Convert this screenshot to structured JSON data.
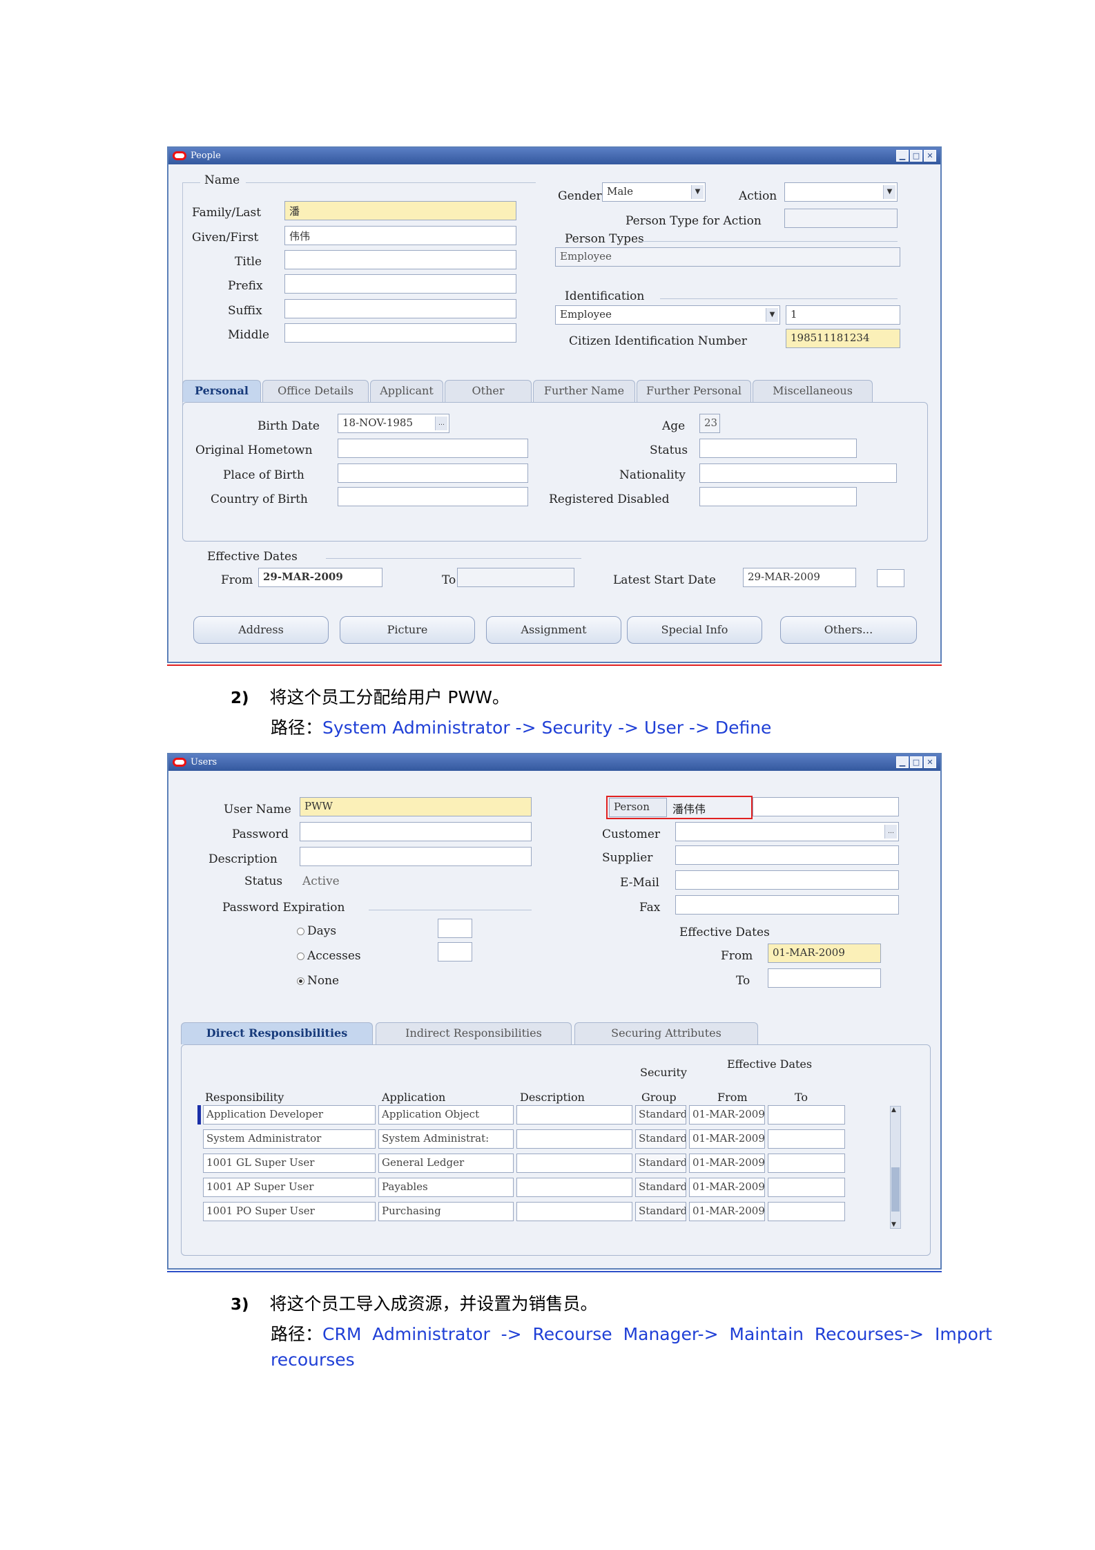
{
  "people_window": {
    "title": "People",
    "name_group": "Name",
    "family_last_label": "Family/Last",
    "family_last_value": "潘",
    "given_first_label": "Given/First",
    "given_first_value": "伟伟",
    "title_label": "Title",
    "prefix_label": "Prefix",
    "suffix_label": "Suffix",
    "middle_label": "Middle",
    "gender_label": "Gender",
    "gender_value": "Male",
    "action_label": "Action",
    "person_type_for_action_label": "Person Type for Action",
    "person_types_label": "Person Types",
    "person_types_value": "Employee",
    "identification_label": "Identification",
    "identification_type": "Employee",
    "identification_number": "1",
    "citizen_id_label": "Citizen Identification Number",
    "citizen_id_value": "198511181234",
    "tabs": [
      "Personal",
      "Office Details",
      "Applicant",
      "Other",
      "Further Name",
      "Further Personal",
      "Miscellaneous"
    ],
    "birth_date_label": "Birth Date",
    "birth_date_value": "18-NOV-1985",
    "original_hometown_label": "Original Hometown",
    "place_of_birth_label": "Place of Birth",
    "country_of_birth_label": "Country of Birth",
    "age_label": "Age",
    "age_value": "23",
    "status_label": "Status",
    "nationality_label": "Nationality",
    "registered_disabled_label": "Registered Disabled",
    "effective_dates_label": "Effective Dates",
    "from_label": "From",
    "from_value": "29-MAR-2009",
    "to_label": "To",
    "latest_start_label": "Latest Start Date",
    "latest_start_value": "29-MAR-2009",
    "buttons": [
      "Address",
      "Picture",
      "Assignment",
      "Special Info",
      "Others..."
    ]
  },
  "step2": {
    "number": "2)",
    "text": "将这个员工分配给用户 PWW。",
    "path_prefix": "路径：",
    "path": "System Administrator -> Security -> User -> Define"
  },
  "users_window": {
    "title": "Users",
    "user_name_label": "User Name",
    "user_name_value": "PWW",
    "password_label": "Password",
    "description_label": "Description",
    "status_label": "Status",
    "status_value": "Active",
    "password_expiration_label": "Password Expiration",
    "days_label": "Days",
    "accesses_label": "Accesses",
    "none_label": "None",
    "person_label": "Person",
    "person_value": "潘伟伟",
    "customer_label": "Customer",
    "supplier_label": "Supplier",
    "email_label": "E-Mail",
    "fax_label": "Fax",
    "effective_dates_label": "Effective Dates",
    "from_label": "From",
    "from_value": "01-MAR-2009",
    "to_label": "To",
    "tabs": [
      "Direct Responsibilities",
      "Indirect Responsibilities",
      "Securing Attributes"
    ],
    "table_headers": {
      "responsibility": "Responsibility",
      "application": "Application",
      "description": "Description",
      "security": "Security",
      "group": "Group",
      "effective_dates": "Effective Dates",
      "from": "From",
      "to": "To"
    },
    "rows": [
      {
        "responsibility": "Application Developer",
        "application": "Application Object",
        "group": "Standard",
        "from": "01-MAR-2009"
      },
      {
        "responsibility": "System Administrator",
        "application": "System Administrat:",
        "group": "Standard",
        "from": "01-MAR-2009"
      },
      {
        "responsibility": "1001 GL Super User",
        "application": "General Ledger",
        "group": "Standard",
        "from": "01-MAR-2009"
      },
      {
        "responsibility": "1001 AP Super User",
        "application": "Payables",
        "group": "Standard",
        "from": "01-MAR-2009"
      },
      {
        "responsibility": "1001 PO Super User",
        "application": "Purchasing",
        "group": "Standard",
        "from": "01-MAR-2009"
      }
    ]
  },
  "step3": {
    "number": "3)",
    "text": "将这个员工导入成资源，并设置为销售员。",
    "path_prefix": "路径：",
    "path_line1": "CRM  Administrator  ->  Recourse  Manager->  Maintain  Recourses->  Import",
    "path_line2": "recourses"
  },
  "colors": {
    "red_separator": "#e02020",
    "blue_separator": "#2d50c8",
    "link": "#1f3fd6",
    "required_field": "#fbf0b8",
    "title_bar": "#33589e"
  }
}
